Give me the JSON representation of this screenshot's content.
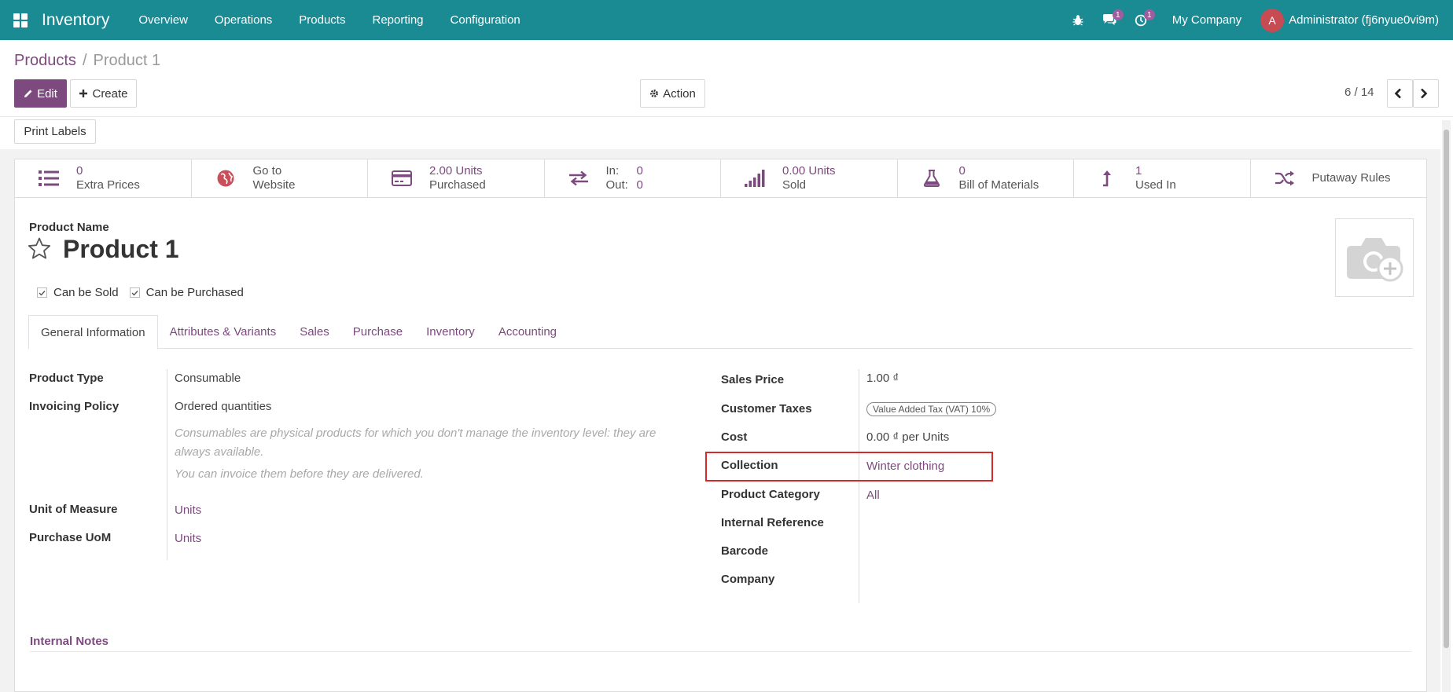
{
  "navbar": {
    "brand": "Inventory",
    "menu": [
      "Overview",
      "Operations",
      "Products",
      "Reporting",
      "Configuration"
    ],
    "messages_count": "1",
    "activities_count": "1",
    "company": "My Company",
    "user_initial": "A",
    "user_name": "Administrator (fj6nyue0vi9m)",
    "colors": {
      "bar": "#1a8a93",
      "badge": "#a05d9e",
      "avatar": "#c64b52"
    }
  },
  "breadcrumb": {
    "parent": "Products",
    "separator": "/",
    "current": "Product 1"
  },
  "buttons": {
    "edit": "Edit",
    "create": "Create",
    "action": "Action",
    "print_labels": "Print Labels"
  },
  "pager": {
    "value": "6 / 14"
  },
  "smart_buttons": [
    {
      "value": "0",
      "label": "Extra Prices",
      "icon": "list-icon"
    },
    {
      "value": "Go to",
      "label": "Website",
      "icon": "globe-icon"
    },
    {
      "value": "2.00 Units",
      "label": "Purchased",
      "icon": "credit-card-icon"
    },
    {
      "in_label": "In:",
      "in_value": "0",
      "out_label": "Out:",
      "out_value": "0",
      "icon": "exchange-icon"
    },
    {
      "value": "0.00 Units",
      "label": "Sold",
      "icon": "signal-icon"
    },
    {
      "value": "0",
      "label": "Bill of Materials",
      "icon": "flask-icon"
    },
    {
      "value": "1",
      "label": "Used In",
      "icon": "level-up-icon"
    },
    {
      "label": "Putaway Rules",
      "icon": "random-icon"
    }
  ],
  "product": {
    "name_label": "Product Name",
    "name": "Product 1",
    "can_be_sold_label": "Can be Sold",
    "can_be_purchased_label": "Can be Purchased",
    "can_be_sold": true,
    "can_be_purchased": true
  },
  "tabs": [
    "General Information",
    "Attributes & Variants",
    "Sales",
    "Purchase",
    "Inventory",
    "Accounting"
  ],
  "active_tab": "General Information",
  "left_fields": {
    "product_type_label": "Product Type",
    "product_type": "Consumable",
    "invoicing_policy_label": "Invoicing Policy",
    "invoicing_policy": "Ordered quantities",
    "help_line1": "Consumables are physical products for which you don't manage the inventory level: they are",
    "help_line2": "always available.",
    "help_line3": "You can invoice them before they are delivered.",
    "uom_label": "Unit of Measure",
    "uom": "Units",
    "purchase_uom_label": "Purchase UoM",
    "purchase_uom": "Units"
  },
  "right_fields": {
    "sales_price_label": "Sales Price",
    "sales_price": "1.00 ₫",
    "customer_taxes_label": "Customer Taxes",
    "customer_tax": "Value Added Tax (VAT) 10%",
    "cost_label": "Cost",
    "cost": "0.00 ₫ per Units",
    "collection_label": "Collection",
    "collection": "Winter clothing",
    "category_label": "Product Category",
    "category": "All",
    "internal_ref_label": "Internal Reference",
    "barcode_label": "Barcode",
    "company_label": "Company"
  },
  "notes": {
    "title": "Internal Notes"
  },
  "highlight_color": "#d62a2a"
}
